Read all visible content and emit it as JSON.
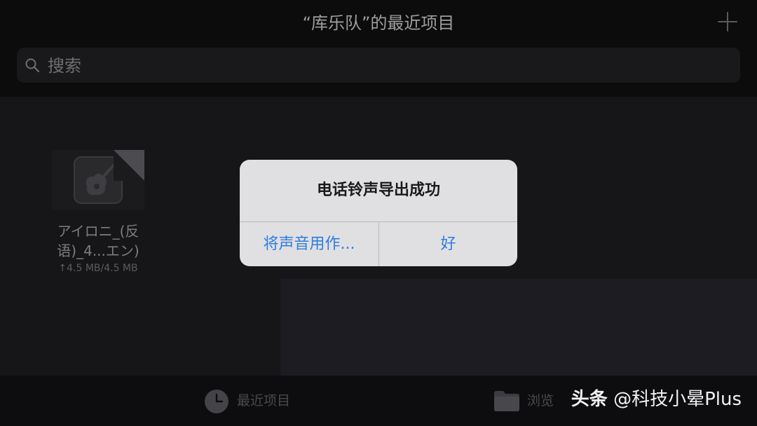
{
  "header": {
    "title": "“库乐队”的最近项目",
    "add_icon": "plus-icon"
  },
  "search": {
    "placeholder": "搜索",
    "value": "",
    "icon": "search-icon"
  },
  "projects": [
    {
      "name": "アイロニ_(反语)_4...エン)",
      "name_line1": "アイロニ_(反",
      "name_line2": "语)_4...エン)",
      "size": "↑4.5 MB/4.5 MB",
      "icon": "guitar-icon"
    }
  ],
  "alert": {
    "title": "电话铃声导出成功",
    "buttons": [
      "将声音用作...",
      "好"
    ]
  },
  "tabbar": {
    "recent_label": "最近项目",
    "browse_label": "浏览",
    "recent_icon": "clock-icon",
    "browse_icon": "folder-icon"
  },
  "watermark": {
    "brand": "头条",
    "handle": "@科技小晕Plus"
  },
  "colors": {
    "accent": "#2f7de0",
    "background": "#161618",
    "alert_background": "#e0e0e2"
  }
}
